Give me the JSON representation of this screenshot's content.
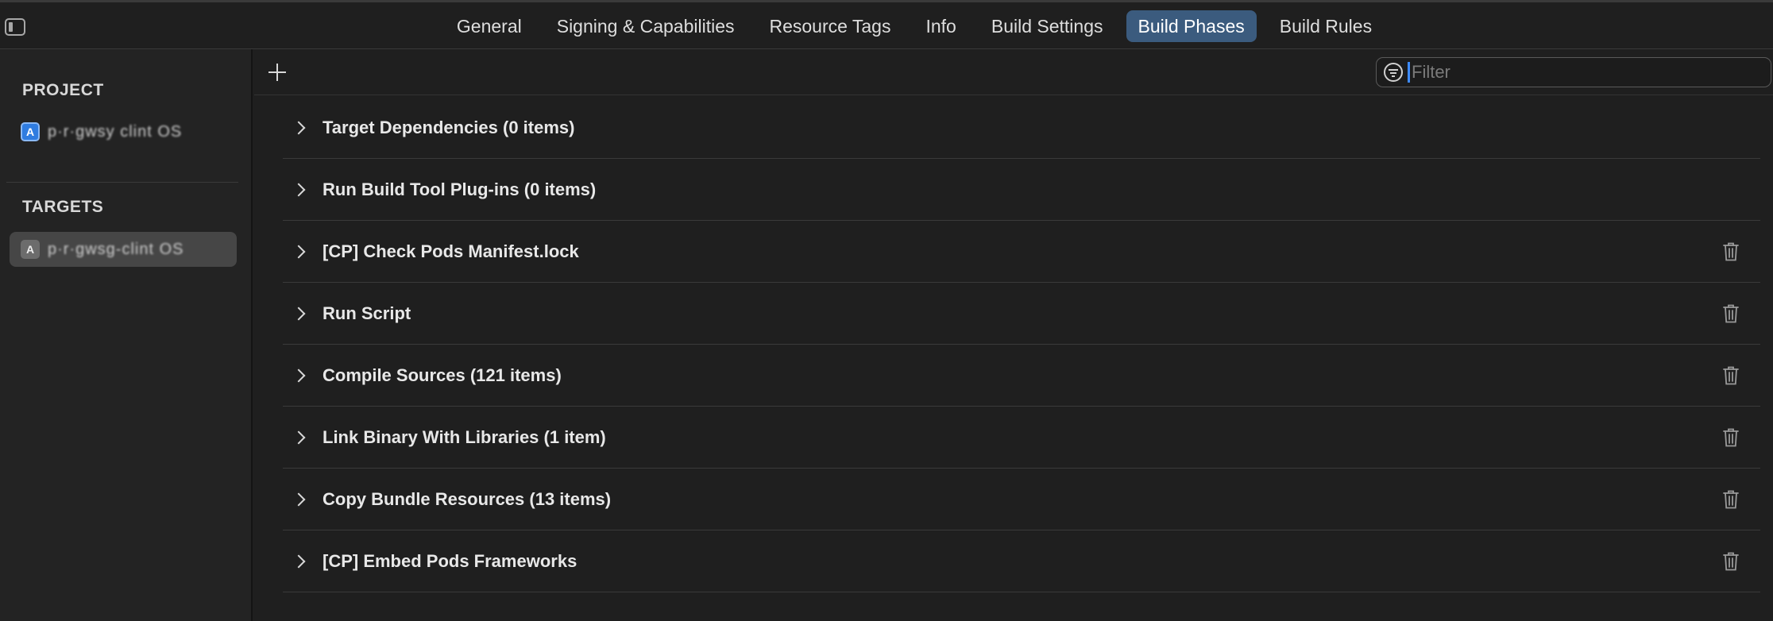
{
  "tabs": [
    {
      "label": "General"
    },
    {
      "label": "Signing & Capabilities"
    },
    {
      "label": "Resource Tags"
    },
    {
      "label": "Info"
    },
    {
      "label": "Build Settings"
    },
    {
      "label": "Build Phases",
      "active": true
    },
    {
      "label": "Build Rules"
    }
  ],
  "sidebar": {
    "project_title": "PROJECT",
    "project_item": "p·r·gwsy clint OS",
    "targets_title": "TARGETS",
    "target_item": "p·r·gwsg-clint OS"
  },
  "filter": {
    "placeholder": "Filter",
    "value": ""
  },
  "phases": [
    {
      "title": "Target Dependencies (0 items)",
      "deletable": false
    },
    {
      "title": "Run Build Tool Plug-ins (0 items)",
      "deletable": false
    },
    {
      "title": "[CP] Check Pods Manifest.lock",
      "deletable": true
    },
    {
      "title": "Run Script",
      "deletable": true
    },
    {
      "title": "Compile Sources (121 items)",
      "deletable": true
    },
    {
      "title": "Link Binary With Libraries (1 item)",
      "deletable": true
    },
    {
      "title": "Copy Bundle Resources (13 items)",
      "deletable": true
    },
    {
      "title": "[CP] Embed Pods Frameworks",
      "deletable": true
    }
  ],
  "colors": {
    "accent_tab": "#3b5b7e",
    "background": "#1f1f1f",
    "caret": "#3d8bff"
  }
}
